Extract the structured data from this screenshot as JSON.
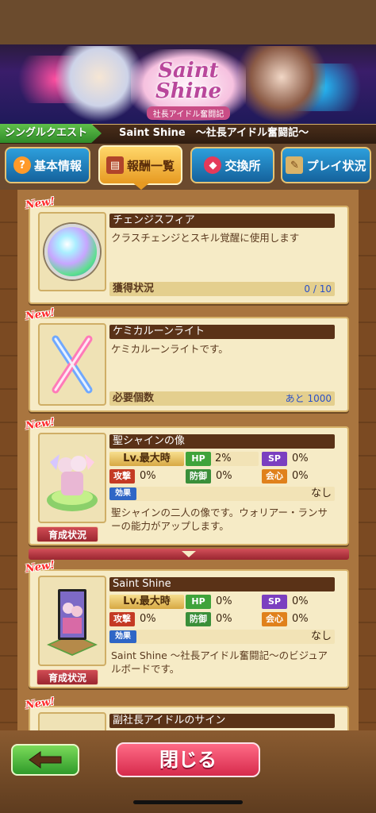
{
  "banner": {
    "logo_main": "Saint Shine",
    "logo_sub": "社長アイドル奮闘記"
  },
  "quest": {
    "type": "シングルクエスト",
    "title": "Saint Shine　～社長アイドル奮闘記～"
  },
  "tabs": [
    {
      "label": "基本情報",
      "icon": "question-icon"
    },
    {
      "label": "報酬一覧",
      "icon": "reward-icon",
      "active": true
    },
    {
      "label": "交換所",
      "icon": "gems-icon"
    },
    {
      "label": "プレイ状況",
      "icon": "scroll-icon"
    }
  ],
  "new_label": "New!",
  "items": [
    {
      "name": "チェンジスフィア",
      "desc": "クラスチェンジとスキル覚醒に使用します",
      "stat_label": "獲得状況",
      "stat_value": "0 / 10",
      "icon": "sphere-icon"
    },
    {
      "name": "ケミカルーンライト",
      "desc": "ケミカルーンライトです。",
      "stat_label": "必要個数",
      "stat_value": "あと 1000",
      "icon": "glowstick-icon"
    }
  ],
  "statues": [
    {
      "name": "聖シャインの像",
      "level": "Lv.最大時",
      "hp_label": "HP",
      "hp": "2%",
      "sp_label": "SP",
      "sp": "0%",
      "atk_label": "攻撃",
      "atk": "0%",
      "def_label": "防御",
      "def": "0%",
      "crit_label": "会心",
      "crit": "0%",
      "effect_label": "効果",
      "effect": "なし",
      "desc": "聖シャインの二人の像です。ウォリアー・ランサーの能力がアップします。",
      "grow_label": "育成状況",
      "icon": "statue-icon"
    },
    {
      "name": "Saint Shine",
      "level": "Lv.最大時",
      "hp_label": "HP",
      "hp": "0%",
      "sp_label": "SP",
      "sp": "0%",
      "atk_label": "攻撃",
      "atk": "0%",
      "def_label": "防御",
      "def": "0%",
      "crit_label": "会心",
      "crit": "0%",
      "effect_label": "効果",
      "effect": "なし",
      "desc": "Saint Shine ～社長アイドル奮闘記～のビジュアルボードです。",
      "grow_label": "育成状況",
      "icon": "board-icon"
    }
  ],
  "partial_item": {
    "name": "副社長アイドルのサイン"
  },
  "footer": {
    "back_icon": "left-arrow-icon",
    "close_label": "閉じる"
  },
  "colors": {
    "hp": "#3fa33a",
    "sp": "#7b3fc0",
    "atk": "#c43a24",
    "def": "#3a8f3a",
    "crit": "#e0811c",
    "accent_blue": "#2a50c8"
  }
}
